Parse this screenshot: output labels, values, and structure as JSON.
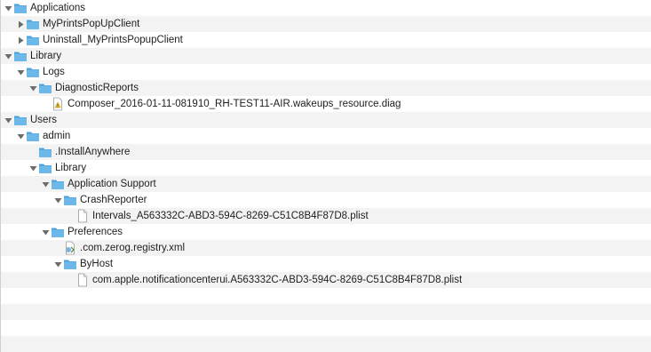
{
  "tree": {
    "rows": [
      {
        "label": "Applications",
        "depth": 0,
        "kind": "folder",
        "toggle": "expanded"
      },
      {
        "label": "MyPrintsPopUpClient",
        "depth": 1,
        "kind": "folder",
        "toggle": "collapsed"
      },
      {
        "label": "Uninstall_MyPrintsPopupClient",
        "depth": 1,
        "kind": "folder",
        "toggle": "collapsed"
      },
      {
        "label": "Library",
        "depth": 0,
        "kind": "folder",
        "toggle": "expanded"
      },
      {
        "label": "Logs",
        "depth": 1,
        "kind": "folder",
        "toggle": "expanded"
      },
      {
        "label": "DiagnosticReports",
        "depth": 2,
        "kind": "folder",
        "toggle": "expanded"
      },
      {
        "label": "Composer_2016-01-11-081910_RH-TEST11-AIR.wakeups_resource.diag",
        "depth": 3,
        "kind": "diag-file",
        "toggle": "none"
      },
      {
        "label": "Users",
        "depth": 0,
        "kind": "folder",
        "toggle": "expanded"
      },
      {
        "label": "admin",
        "depth": 1,
        "kind": "folder",
        "toggle": "expanded"
      },
      {
        "label": ".InstallAnywhere",
        "depth": 2,
        "kind": "folder",
        "toggle": "none"
      },
      {
        "label": "Library",
        "depth": 2,
        "kind": "folder",
        "toggle": "expanded"
      },
      {
        "label": "Application Support",
        "depth": 3,
        "kind": "folder",
        "toggle": "expanded"
      },
      {
        "label": "CrashReporter",
        "depth": 4,
        "kind": "folder",
        "toggle": "expanded"
      },
      {
        "label": "Intervals_A563332C-ABD3-594C-8269-C51C8B4F87D8.plist",
        "depth": 5,
        "kind": "file",
        "toggle": "none"
      },
      {
        "label": "Preferences",
        "depth": 3,
        "kind": "folder",
        "toggle": "expanded"
      },
      {
        "label": ".com.zerog.registry.xml",
        "depth": 4,
        "kind": "xml-file",
        "toggle": "none"
      },
      {
        "label": "ByHost",
        "depth": 4,
        "kind": "folder",
        "toggle": "expanded"
      },
      {
        "label": "com.apple.notificationcenterui.A563332C-ABD3-594C-8269-C51C8B4F87D8.plist",
        "depth": 5,
        "kind": "file",
        "toggle": "none"
      }
    ],
    "empty_rows": 4
  },
  "colors": {
    "folder_body": "#6cb8e8",
    "folder_tab": "#4f9fd6",
    "triangle": "#6b6b6b",
    "stripe": "#f3f3f3"
  }
}
